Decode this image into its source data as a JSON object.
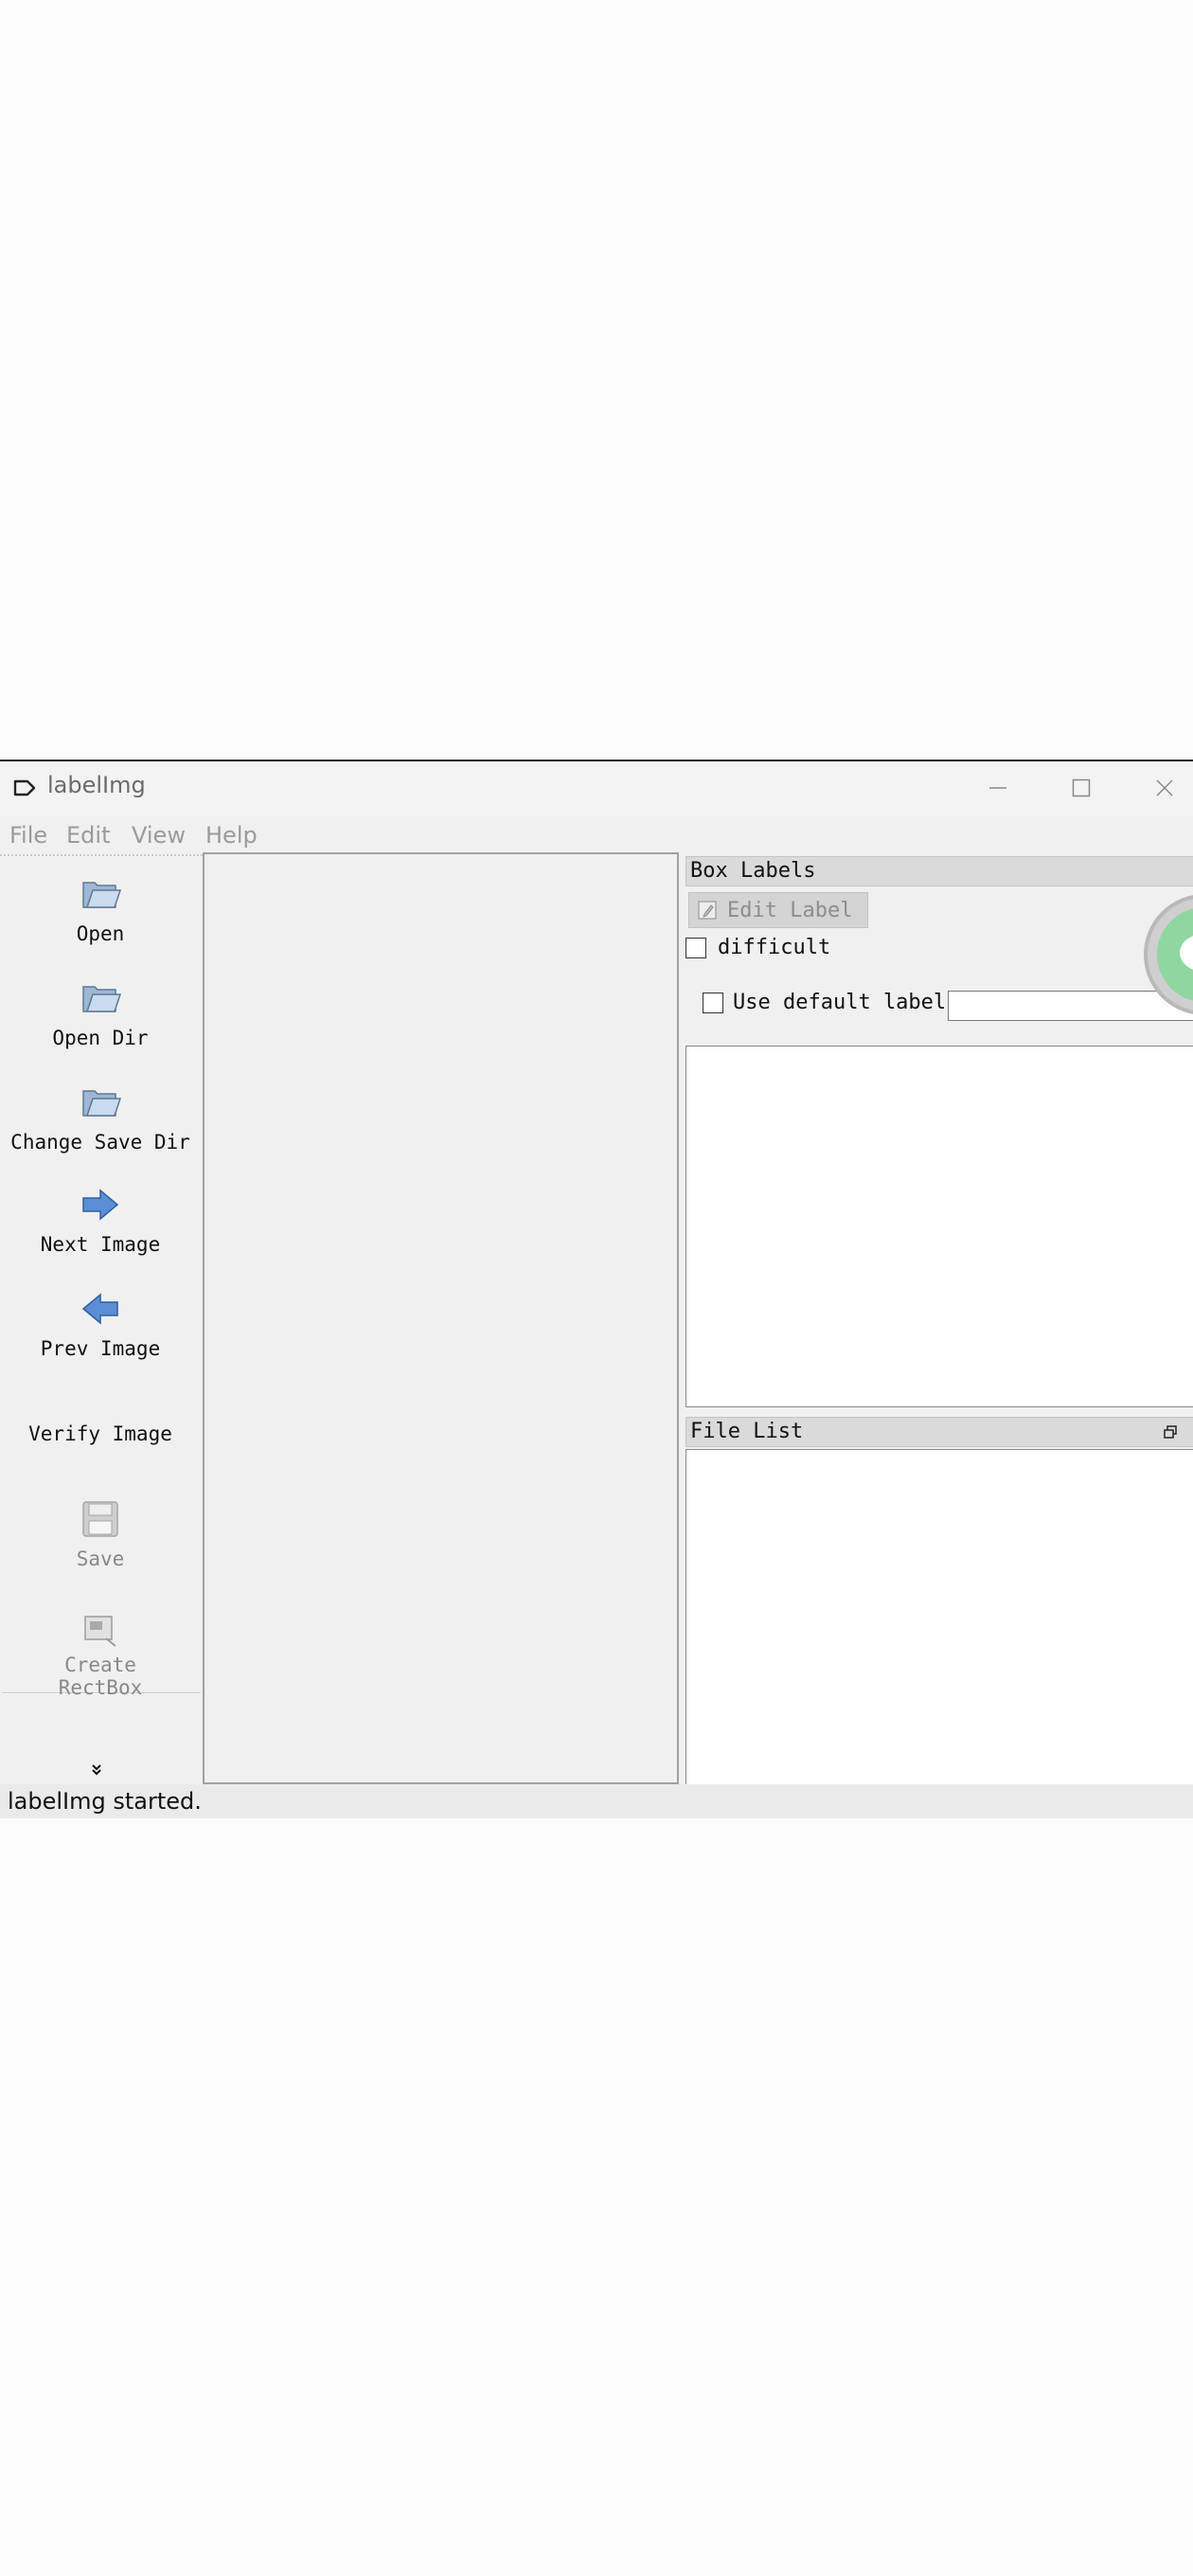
{
  "window": {
    "title": "labelImg",
    "controls": [
      "minimize",
      "maximize",
      "close"
    ]
  },
  "menu": {
    "items": [
      "File",
      "Edit",
      "View",
      "Help"
    ]
  },
  "toolbar": {
    "open": "Open",
    "open_dir": "Open Dir",
    "change_save_dir": "Change Save Dir",
    "next_image": "Next Image",
    "prev_image": "Prev Image",
    "verify_image": "Verify Image",
    "save": "Save",
    "create_rectbox_line1": "Create",
    "create_rectbox_line2": "RectBox",
    "more": "»"
  },
  "box_labels": {
    "header": "Box Labels",
    "edit_label": "Edit Label",
    "difficult": "difficult",
    "use_default_label": "Use default label",
    "default_label_value": "",
    "labels": []
  },
  "file_list": {
    "header": "File List",
    "files": []
  },
  "status": {
    "text": "labelImg started."
  },
  "colors": {
    "accent_blue": "#4a7cc0",
    "floating_button_green": "#8fd7a0"
  }
}
